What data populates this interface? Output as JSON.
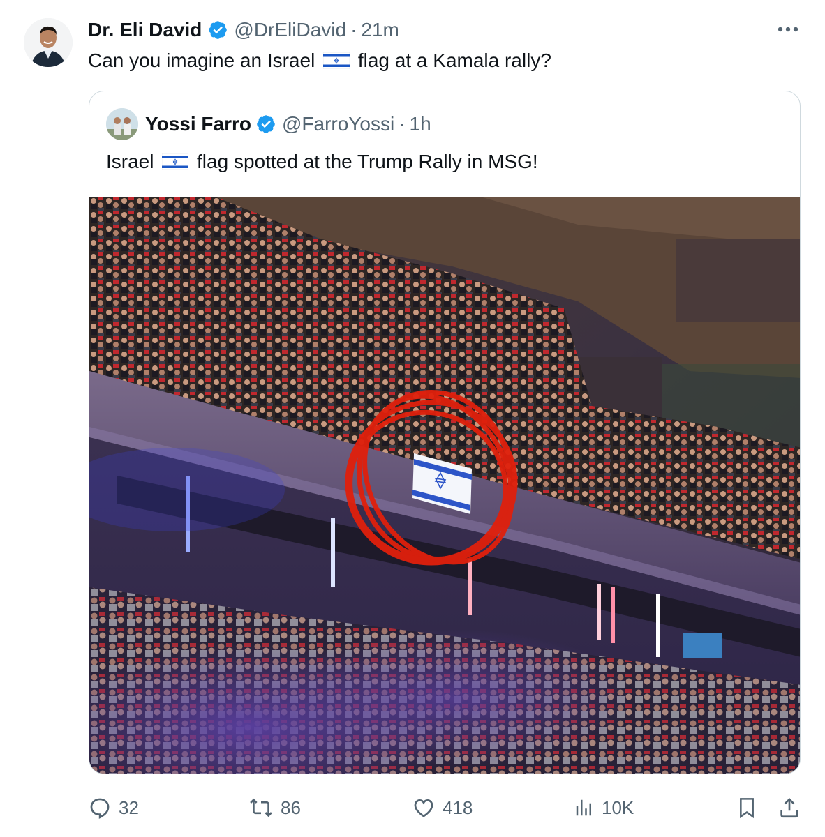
{
  "tweet": {
    "author_name": "Dr. Eli David",
    "handle": "@DrEliDavid",
    "separator": "·",
    "time": "21m",
    "text_before_flag": "Can you imagine an Israel",
    "text_after_flag": "flag at a Kamala rally?"
  },
  "quoted_tweet": {
    "author_name": "Yossi Farro",
    "handle": "@FarroYossi",
    "separator": "·",
    "time": "1h",
    "text_before_flag": "Israel",
    "text_after_flag": "flag spotted at the Trump Rally in MSG!"
  },
  "actions": {
    "replies": "32",
    "reposts": "86",
    "likes": "418",
    "views": "10K"
  },
  "colors": {
    "verified": "#1d9bf0",
    "muted": "#536471",
    "border": "#cfd9de",
    "circle": "#e0200c"
  },
  "icons": [
    "more-icon",
    "verified-badge-icon",
    "israel-flag-icon",
    "reply-icon",
    "repost-icon",
    "like-icon",
    "views-icon",
    "bookmark-icon",
    "share-icon"
  ]
}
